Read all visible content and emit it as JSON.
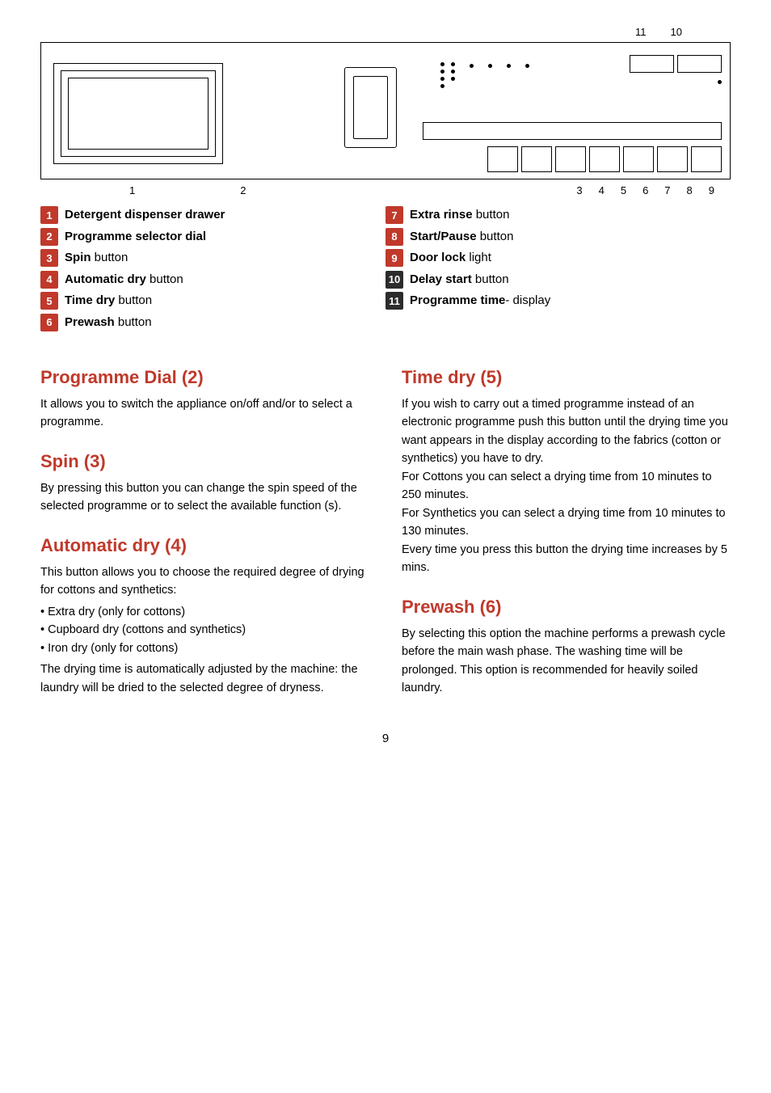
{
  "page": {
    "number": "9"
  },
  "diagram": {
    "top_labels": [
      "11",
      "10"
    ],
    "bottom_labels_left": [
      "1",
      "2"
    ],
    "bottom_labels_right": [
      "3",
      "4",
      "5",
      "6",
      "7",
      "8",
      "9"
    ]
  },
  "parts": {
    "left_col": [
      {
        "num": "1",
        "label_bold": "Detergent dispenser drawer",
        "label_rest": ""
      },
      {
        "num": "2",
        "label_bold": "Programme selector dial",
        "label_rest": ""
      },
      {
        "num": "3",
        "label_bold": "Spin",
        "label_rest": " button"
      },
      {
        "num": "4",
        "label_bold": "Automatic dry",
        "label_rest": " button"
      },
      {
        "num": "5",
        "label_bold": "Time dry",
        "label_rest": " button"
      },
      {
        "num": "6",
        "label_bold": "Prewash",
        "label_rest": " button"
      }
    ],
    "right_col": [
      {
        "num": "7",
        "label_bold": "Extra rinse",
        "label_rest": " button"
      },
      {
        "num": "8",
        "label_bold": "Start/Pause",
        "label_rest": " button"
      },
      {
        "num": "9",
        "label_bold": "Door lock",
        "label_rest": " light"
      },
      {
        "num": "10",
        "label_bold": "Delay start",
        "label_rest": " button"
      },
      {
        "num": "11",
        "label_bold": "Programme time",
        "label_rest": "- display"
      }
    ]
  },
  "sections": {
    "left": [
      {
        "title": "Programme Dial (2)",
        "body": "It allows you to switch the appliance on/off and/or to select a programme.",
        "list": []
      },
      {
        "title": "Spin (3)",
        "body": "By pressing this button you can change the spin speed of the selected programme or to select the available function (s).",
        "list": []
      },
      {
        "title": "Automatic dry (4)",
        "body": "This button allows you to choose the required degree of drying for cottons and synthetics:",
        "list": [
          "Extra dry (only for cottons)",
          "Cupboard dry (cottons and synthetics)",
          "Iron dry (only for cottons)"
        ],
        "body2": "The drying time is automatically adjusted by the machine: the laundry will be dried to the selected degree of dryness."
      }
    ],
    "right": [
      {
        "title": "Time dry (5)",
        "body": "If you wish to carry out a timed programme instead of an electronic programme push this button until the drying time you want appears in the display according to the fabrics (cotton or synthetics) you have to dry.\nFor Cottons you can select a drying time from 10 minutes to 250 minutes.\nFor Synthetics you can select a drying time from 10 minutes to 130 minutes.\nEvery time you press this button the drying time increases by 5 mins."
      },
      {
        "title": "Prewash (6)",
        "body": "By selecting this option the machine performs a prewash cycle before the main wash phase. The washing time will be prolonged. This option is recommended for heavily soiled laundry."
      }
    ]
  }
}
